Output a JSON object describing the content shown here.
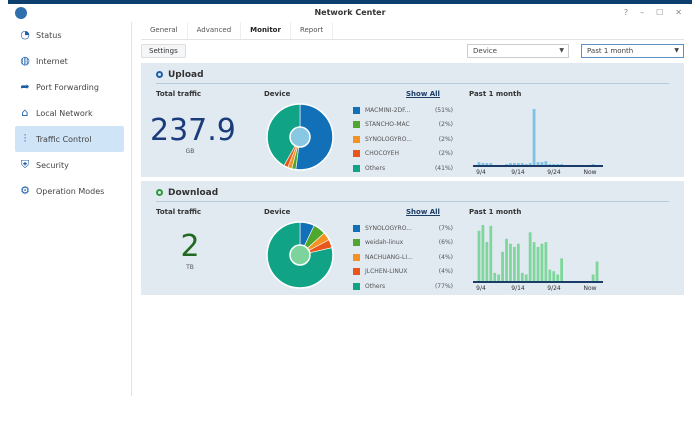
{
  "window": {
    "title": "Network Center",
    "controls": [
      "?",
      "–",
      "☐",
      "✕"
    ]
  },
  "sidebar": {
    "items": [
      {
        "label": "Status",
        "icon": "gauge-icon",
        "glyph": "◔"
      },
      {
        "label": "Internet",
        "icon": "globe-icon",
        "glyph": "◍"
      },
      {
        "label": "Port Forwarding",
        "icon": "arrow-forward-icon",
        "glyph": "➦"
      },
      {
        "label": "Local Network",
        "icon": "home-network-icon",
        "glyph": "⌂"
      },
      {
        "label": "Traffic Control",
        "icon": "sliders-icon",
        "glyph": "⫶",
        "active": true
      },
      {
        "label": "Security",
        "icon": "shield-icon",
        "glyph": "⛨"
      },
      {
        "label": "Operation Modes",
        "icon": "router-gear-icon",
        "glyph": "⚙"
      }
    ]
  },
  "tabs": [
    {
      "label": "General"
    },
    {
      "label": "Advanced"
    },
    {
      "label": "Monitor",
      "active": true
    },
    {
      "label": "Report"
    }
  ],
  "toolbar": {
    "settings": "Settings",
    "device_select": "Device",
    "period_select": "Past 1 month"
  },
  "colors": {
    "blue": "#1170b8",
    "green": "#4fa82d",
    "orange": "#f29222",
    "red": "#e8561b",
    "teal": "#11a386",
    "upload_bar": "#7dc2e4",
    "download_bar": "#7ed69b"
  },
  "upload": {
    "title": "Upload",
    "total_label": "Total traffic",
    "total": "237.9",
    "unit": "GB",
    "device_label": "Device",
    "show_all": "Show All",
    "period_label": "Past 1 month",
    "legend": [
      {
        "name": "MACMINI-2DF...",
        "pct": "(51%)",
        "value": 51,
        "color": "#1170b8"
      },
      {
        "name": "STANCHO-MAC",
        "pct": "(2%)",
        "value": 2,
        "color": "#4fa82d"
      },
      {
        "name": "SYNOLOGYRO...",
        "pct": "(2%)",
        "value": 2,
        "color": "#f29222"
      },
      {
        "name": "CHOCOYEH",
        "pct": "(2%)",
        "value": 2,
        "color": "#e8561b"
      },
      {
        "name": "Others",
        "pct": "(41%)",
        "value": 41,
        "color": "#11a386"
      }
    ],
    "x_ticks": [
      "9/4",
      "9/14",
      "9/24",
      "Now"
    ],
    "bars": [
      3,
      2,
      2,
      2,
      0,
      0,
      0,
      1,
      2,
      2,
      2,
      2,
      1,
      2,
      62,
      3,
      3,
      4,
      1,
      1,
      1,
      1,
      0,
      0,
      0,
      0,
      0,
      0,
      0,
      1,
      0
    ]
  },
  "download": {
    "title": "Download",
    "total_label": "Total traffic",
    "total": "2",
    "unit": "TB",
    "device_label": "Device",
    "show_all": "Show All",
    "period_label": "Past 1 month",
    "legend": [
      {
        "name": "SYNOLOGYRO...",
        "pct": "(7%)",
        "value": 7,
        "color": "#1170b8"
      },
      {
        "name": "weidah-linux",
        "pct": "(6%)",
        "value": 6,
        "color": "#4fa82d"
      },
      {
        "name": "NACHUANG-LI...",
        "pct": "(4%)",
        "value": 4,
        "color": "#f29222"
      },
      {
        "name": "JLCHEN-LINUX",
        "pct": "(4%)",
        "value": 4,
        "color": "#e8561b"
      },
      {
        "name": "Others",
        "pct": "(77%)",
        "value": 77,
        "color": "#11a386"
      }
    ],
    "x_ticks": [
      "9/4",
      "9/14",
      "9/24",
      "Now"
    ],
    "bars": [
      155,
      185,
      120,
      170,
      25,
      20,
      90,
      130,
      115,
      105,
      115,
      25,
      20,
      150,
      120,
      105,
      115,
      120,
      35,
      30,
      20,
      70,
      0,
      0,
      0,
      0,
      0,
      0,
      0,
      20,
      60
    ]
  }
}
